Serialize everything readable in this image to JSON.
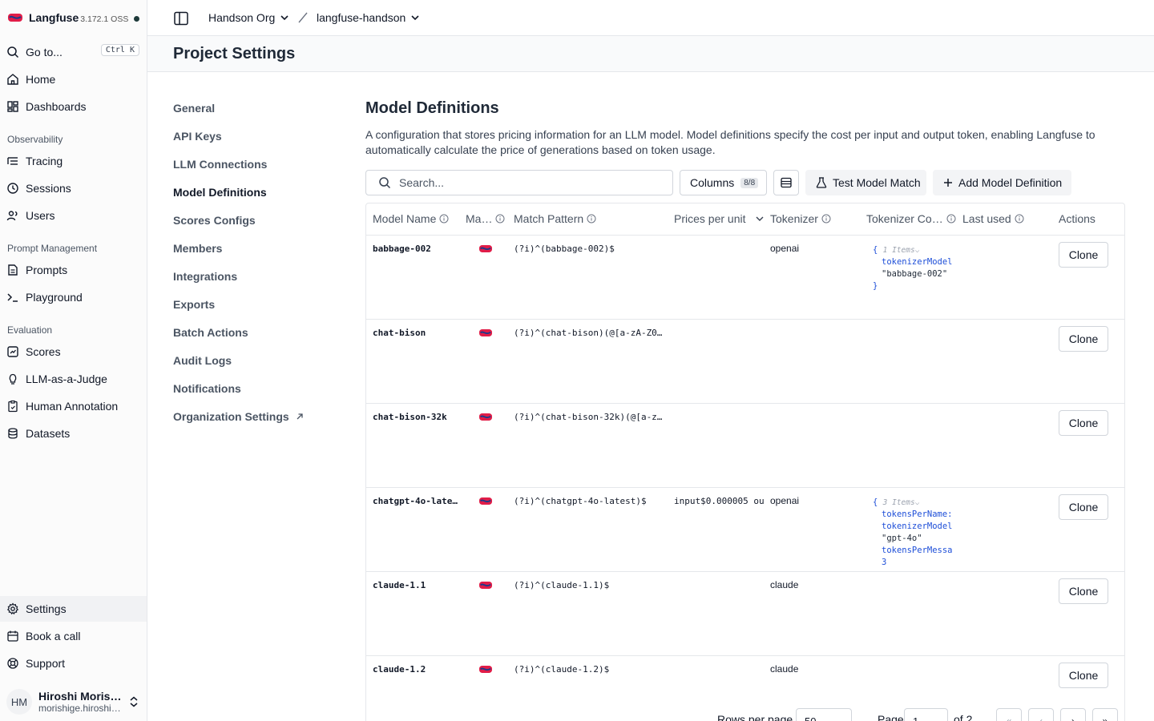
{
  "app": {
    "name": "Langfuse",
    "version": "3.172.1 OSS"
  },
  "sidebar": {
    "goto": {
      "label": "Go to...",
      "shortcut": "Ctrl K"
    },
    "top_items": [
      {
        "label": "Home",
        "icon": "home-icon"
      },
      {
        "label": "Dashboards",
        "icon": "dashboard-icon"
      }
    ],
    "sections": [
      {
        "label": "Observability",
        "items": [
          {
            "label": "Tracing",
            "icon": "tracing-icon"
          },
          {
            "label": "Sessions",
            "icon": "clock-icon"
          },
          {
            "label": "Users",
            "icon": "users-icon"
          }
        ]
      },
      {
        "label": "Prompt Management",
        "items": [
          {
            "label": "Prompts",
            "icon": "file-text-icon"
          },
          {
            "label": "Playground",
            "icon": "terminal-icon"
          }
        ]
      },
      {
        "label": "Evaluation",
        "items": [
          {
            "label": "Scores",
            "icon": "scores-icon"
          },
          {
            "label": "LLM-as-a-Judge",
            "icon": "lightbulb-icon"
          },
          {
            "label": "Human Annotation",
            "icon": "annotation-icon"
          },
          {
            "label": "Datasets",
            "icon": "database-icon"
          }
        ]
      }
    ],
    "bottom_items": [
      {
        "label": "Settings",
        "icon": "gear-icon",
        "active": true
      },
      {
        "label": "Book a call",
        "icon": "calendar-icon"
      },
      {
        "label": "Support",
        "icon": "lifebuoy-icon"
      }
    ],
    "user": {
      "initials": "HM",
      "name": "Hiroshi Moris…",
      "email": "morishige.hiroshi…"
    }
  },
  "topbar": {
    "org": "Handson Org",
    "project": "langfuse-handson"
  },
  "page": {
    "title": "Project Settings"
  },
  "settings_nav": [
    {
      "label": "General"
    },
    {
      "label": "API Keys"
    },
    {
      "label": "LLM Connections"
    },
    {
      "label": "Model Definitions",
      "active": true
    },
    {
      "label": "Scores Configs"
    },
    {
      "label": "Members"
    },
    {
      "label": "Integrations"
    },
    {
      "label": "Exports"
    },
    {
      "label": "Batch Actions"
    },
    {
      "label": "Audit Logs"
    },
    {
      "label": "Notifications"
    },
    {
      "label": "Organization Settings",
      "external": true
    }
  ],
  "content": {
    "title": "Model Definitions",
    "description": "A configuration that stores pricing information for an LLM model. Model definitions specify the cost per input and output token, enabling Langfuse to automatically calculate the price of generations based on token usage.",
    "search_placeholder": "Search...",
    "columns_label": "Columns",
    "columns_badge": "8/8",
    "test_match_label": "Test Model Match",
    "add_label": "Add Model Definition"
  },
  "table": {
    "headers": [
      "Model Name",
      "Ma…",
      "Match Pattern",
      "Prices per unit",
      "Tokenizer",
      "Tokenizer Co…",
      "Last used",
      "Actions"
    ],
    "clone_label": "Clone",
    "rows": [
      {
        "name": "babbage-002",
        "pattern": "(?i)^(babbage-002)$",
        "prices": "",
        "tokenizer": "openai",
        "config": {
          "count": "1 Items",
          "lines": [
            [
              "tokenizerModel",
              "\"babbage-002\""
            ]
          ]
        }
      },
      {
        "name": "chat-bison",
        "pattern": "(?i)^(chat-bison)(@[a-zA-Z0…",
        "prices": "",
        "tokenizer": "",
        "config": null
      },
      {
        "name": "chat-bison-32k",
        "pattern": "(?i)^(chat-bison-32k)(@[a-z…",
        "prices": "",
        "tokenizer": "",
        "config": null
      },
      {
        "name": "chatgpt-4o-late…",
        "pattern": "(?i)^(chatgpt-4o-latest)$",
        "prices": "input$0.000005 ou",
        "tokenizer": "openai",
        "config": {
          "count": "3 Items",
          "lines": [
            [
              "tokensPerName:",
              ""
            ],
            [
              "tokenizerModel",
              "\"gpt-4o\""
            ],
            [
              "tokensPerMessa",
              "3"
            ]
          ]
        }
      },
      {
        "name": "claude-1.1",
        "pattern": "(?i)^(claude-1.1)$",
        "prices": "",
        "tokenizer": "claude",
        "config": null
      },
      {
        "name": "claude-1.2",
        "pattern": "(?i)^(claude-1.2)$",
        "prices": "",
        "tokenizer": "claude",
        "config": null
      }
    ]
  },
  "pager": {
    "rows_label": "Rows per page",
    "rows_value": "50",
    "page_label": "Page",
    "page_value": "1",
    "of_label": "of 2"
  }
}
